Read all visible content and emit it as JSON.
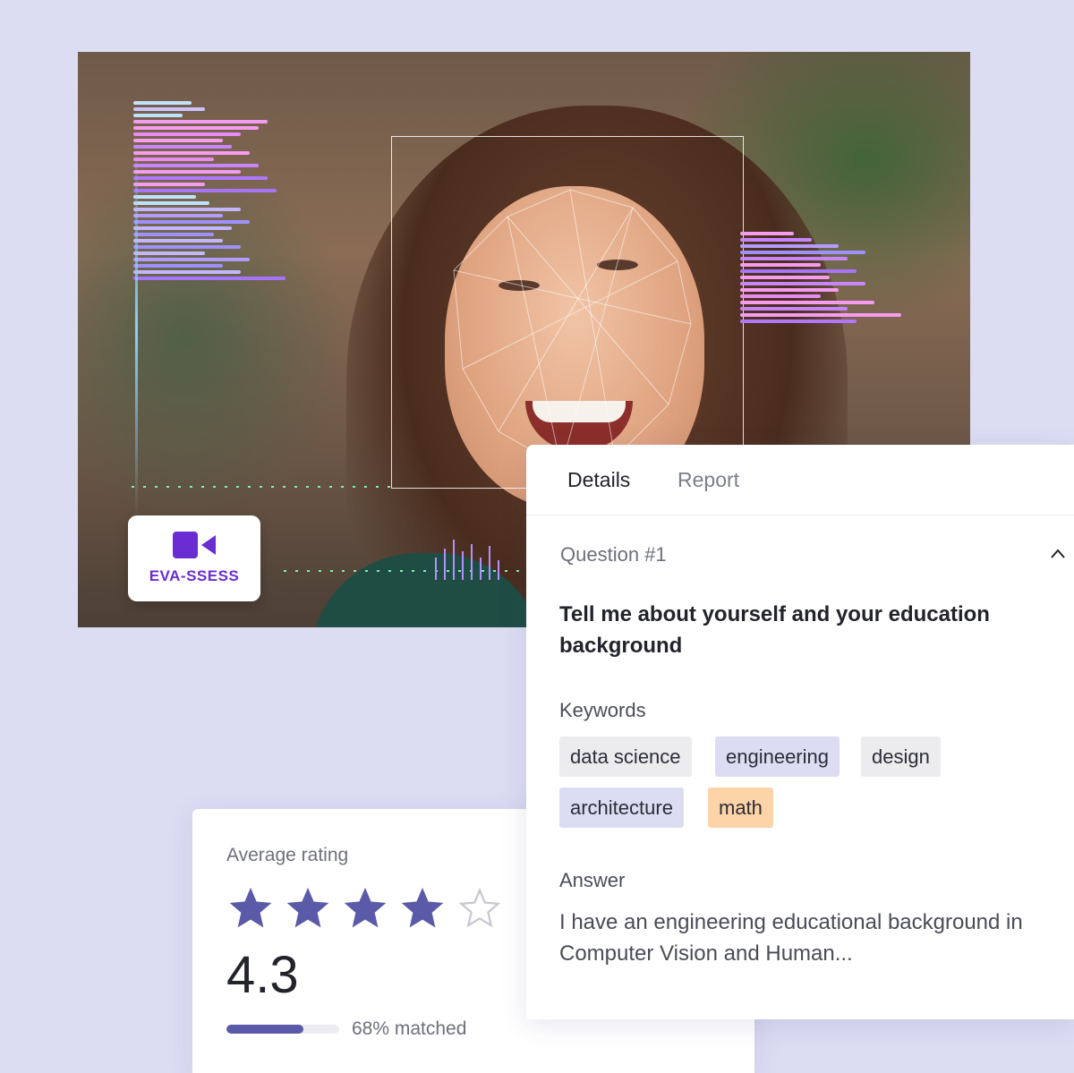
{
  "brand": {
    "logo_text": "EVA-SSESS",
    "logo_icon": "video-camera-icon",
    "accent_color": "#6a2dd1"
  },
  "details_panel": {
    "tabs": [
      {
        "label": "Details",
        "active": true
      },
      {
        "label": "Report",
        "active": false
      }
    ],
    "question_label": "Question #1",
    "question_text": "Tell me about yourself and your education background",
    "keywords_label": "Keywords",
    "keywords": [
      {
        "text": "data science",
        "color": "#ececef"
      },
      {
        "text": "engineering",
        "color": "#dcdcf3"
      },
      {
        "text": "design",
        "color": "#ececef"
      },
      {
        "text": "architecture",
        "color": "#dcdcf3"
      },
      {
        "text": "math",
        "color": "#fdd3a8"
      }
    ],
    "answer_label": "Answer",
    "answer_text": "I have an engineering educational background in Computer Vision and Human..."
  },
  "rating_card": {
    "label": "Average rating",
    "stars_filled": 4,
    "stars_total": 5,
    "score": "4.3",
    "match_percent": 68,
    "match_text": "68% matched"
  }
}
